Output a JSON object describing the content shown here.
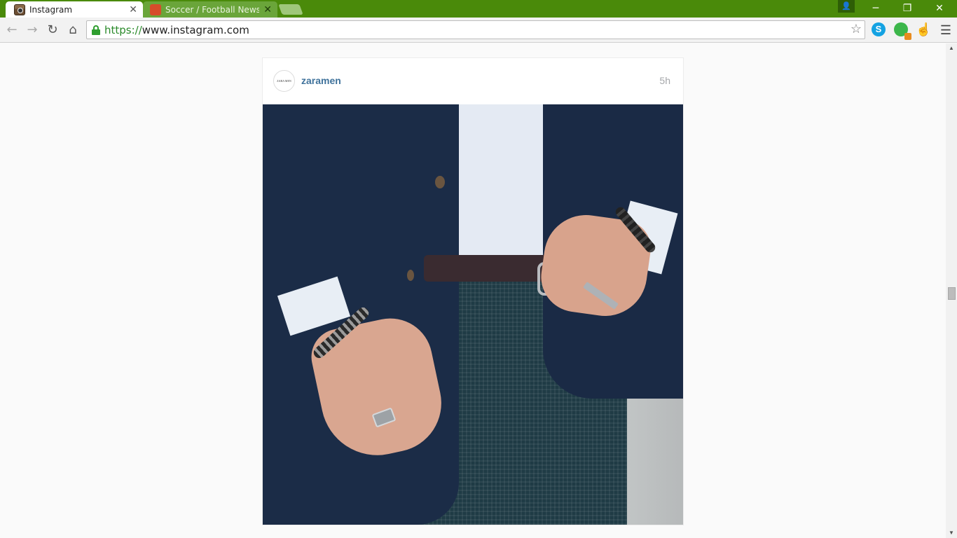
{
  "browser": {
    "tabs": [
      {
        "title": "Instagram",
        "active": true,
        "favicon": "instagram-icon"
      },
      {
        "title": "Soccer / Football News an",
        "active": false,
        "favicon": "soccer-site-icon"
      }
    ],
    "url_scheme": "https://",
    "url_host": "www.instagram.com",
    "colors": {
      "frame": "#4a8a0a",
      "scheme": "#2a8a2a"
    }
  },
  "post": {
    "avatar_text": "ZARA MEN",
    "username": "zaramen",
    "time_ago": "5h",
    "image_alt_icon": "post-photo"
  }
}
